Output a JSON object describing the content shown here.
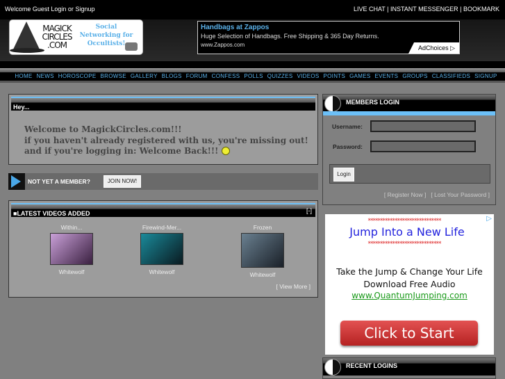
{
  "topbar": {
    "welcome": "Welcome Guest",
    "login": "Login",
    "or": "or",
    "signup": "Signup",
    "right_links": "LIVE CHAT | INSTANT MESSENGER | BOOKMARK"
  },
  "logo": {
    "name_lines": [
      "MAGICK",
      "CIRCLES",
      ".COM"
    ],
    "tagline": "Social Networking for Occultists!"
  },
  "ad_top": {
    "title": "Handbags at Zappos",
    "desc": "Huge Selection of Handbags. Free Shipping & 365 Day Returns.",
    "url": "www.Zappos.com",
    "adchoices": "AdChoices ▷"
  },
  "nav": [
    "HOME",
    "NEWS",
    "HOROSCOPE",
    "BROWSE",
    "GALLERY",
    "BLOGS",
    "FORUM",
    "CONFESS",
    "POLLS",
    "QUIZZES",
    "VIDEOS",
    "POINTS",
    "GAMES",
    "EVENTS",
    "GROUPS",
    "CLASSIFIEDS",
    "SIGNUP"
  ],
  "hey": {
    "title": "Hey...",
    "lines": [
      "Welcome to MagickCircles.com!!!",
      "if you haven't already registered with us, you're missing out!",
      "and if you're logging in: Welcome Back!!!"
    ]
  },
  "not_member": {
    "label": "NOT YET A MEMBER?",
    "button": "JOIN NOW!"
  },
  "videos": {
    "title": "LATEST VIDEOS ADDED",
    "toggle": "[-]",
    "items": [
      {
        "title": "Within...",
        "user": "Whitewolf",
        "colors": [
          "#c9a0d8",
          "#3a2040"
        ]
      },
      {
        "title": "Firewind-Mer...",
        "user": "Whitewolf",
        "colors": [
          "#1a8a9a",
          "#0a1a20"
        ]
      },
      {
        "title": "Frozen",
        "user": "Whitewolf",
        "colors": [
          "#6a8090",
          "#1a2028"
        ]
      }
    ],
    "more": "[ View More ]"
  },
  "login": {
    "title": "MEMBERS LOGIN",
    "username_label": "Username:",
    "password_label": "Password:",
    "username_value": "",
    "password_value": "",
    "button": "Login",
    "register": "[ Register Now ]",
    "lost": "[ Lost Your Password ]"
  },
  "ad_side": {
    "stars": "******************************",
    "headline": "Jump Into a New Life",
    "line1": "Take the Jump & Change Your Life",
    "line2": "Download Free Audio",
    "url": "www.QuantumJumping.com",
    "cta": "Click to Start",
    "adchoice_icon": "▷"
  },
  "recent": {
    "title": "RECENT LOGINS"
  },
  "colors": {
    "accent": "#5ab0e8",
    "background": "#808080"
  }
}
